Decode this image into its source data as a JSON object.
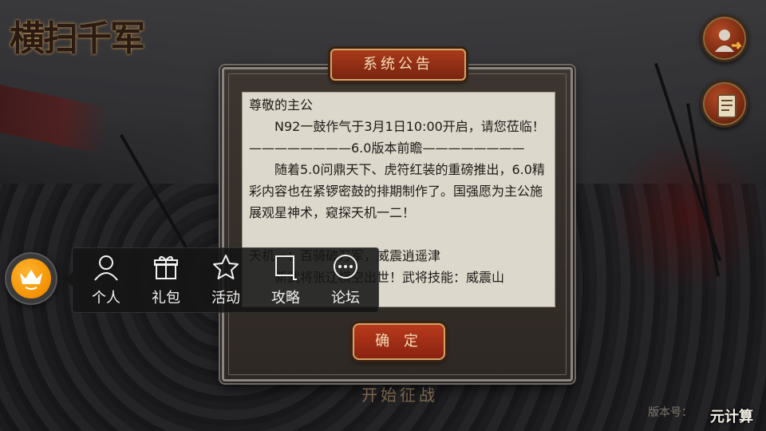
{
  "game": {
    "logo_text": "横扫千军"
  },
  "side_buttons": [
    {
      "name": "account-button",
      "icon": "account-switch-icon"
    },
    {
      "name": "notice-button",
      "icon": "scroll-notice-icon"
    }
  ],
  "dialog": {
    "title": "系统公告",
    "greeting": "尊敬的主公",
    "lines": [
      "N92一鼓作气于3月1日10:00开启，请您莅临！",
      "————————6.0版本前瞻————————",
      "随着5.0问鼎天下、虎符红装的重磅推出，6.0精彩内容也在紧锣密鼓的排期制作了。国强愿为主公施展观星神术，窥探天机一二！",
      "天机一：百骑破万军，威震逍遥津",
      "新武将张辽横空出世！武将技能：威震山"
    ],
    "confirm_label": "确 定",
    "underlying_button": "开始征战"
  },
  "floating_menu": {
    "items": [
      {
        "label": "个人",
        "icon": "person-icon"
      },
      {
        "label": "礼包",
        "icon": "gift-icon"
      },
      {
        "label": "活动",
        "icon": "star-icon"
      },
      {
        "label": "攻略",
        "icon": "flag-icon"
      },
      {
        "label": "论坛",
        "icon": "chat-bubble-icon"
      }
    ]
  },
  "footer": {
    "version_label": "版本号：",
    "watermark": "元计算"
  },
  "colors": {
    "accent_red": "#a83a1a",
    "gold_border": "#d3a36a",
    "float_orange": "#f39200",
    "content_bg": "#ddd8cc"
  }
}
